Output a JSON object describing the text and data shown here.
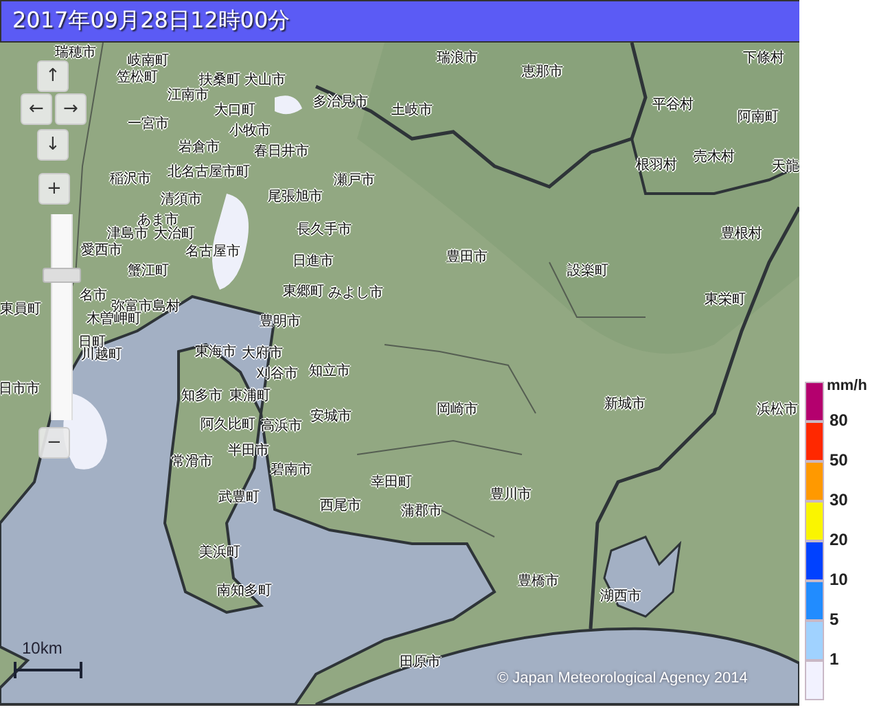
{
  "header": {
    "title": "2017年09月28日12時00分"
  },
  "map": {
    "place_labels": [
      "瑞穂市",
      "岐南町",
      "笠松町",
      "扶桑町",
      "犬山市",
      "江南市",
      "大口町",
      "多治見市",
      "土岐市",
      "瑞浪市",
      "恵那市",
      "平谷村",
      "下條村",
      "阿南町",
      "根羽村",
      "売木村",
      "天龍",
      "豊根村",
      "一宮市",
      "小牧市",
      "岩倉市",
      "春日井市",
      "北名古屋市町",
      "稲沢市",
      "瀬戸市",
      "清須市",
      "尾張旭市",
      "あま市",
      "津島市",
      "大治町",
      "長久手市",
      "愛西市",
      "名古屋市",
      "日進市",
      "蟹江町",
      "豊田市",
      "設楽町",
      "東栄町",
      "東郷町",
      "みよし市",
      "弥富市島村",
      "木曽岬町",
      "東員町",
      "名市",
      "豊明市",
      "日町",
      "川越町",
      "東海市",
      "大府市",
      "刈谷市",
      "知立市",
      "日市市",
      "知多市",
      "東浦町",
      "安城市",
      "岡崎市",
      "新城市",
      "浜松市",
      "阿久比町",
      "高浜市",
      "半田市",
      "常滑市",
      "碧南市",
      "幸田町",
      "西尾市",
      "武豊町",
      "蒲郡市",
      "豊川市",
      "美浜町",
      "南知多町",
      "豊橋市",
      "湖西市",
      "田原市"
    ],
    "pan_buttons": [
      {
        "symbol": "↑"
      },
      {
        "symbol": "←"
      },
      {
        "symbol": "→"
      },
      {
        "symbol": "↓"
      }
    ],
    "zoom_in": "+",
    "zoom_out": "−",
    "zoom_slider": {
      "level": 0.72
    },
    "scale": "10km",
    "copyright": "© Japan Meteorological Agency 2014"
  },
  "legend": {
    "unit": "mm/h",
    "levels": [
      {
        "color": "#b4006e"
      },
      {
        "color": "#ff2800",
        "label": "80"
      },
      {
        "color": "#ff9900",
        "label": "50"
      },
      {
        "color": "#faf500",
        "label": "30"
      },
      {
        "color": "#0041ff",
        "label": "20"
      },
      {
        "color": "#218cff",
        "label": "10"
      },
      {
        "color": "#a0d2ff",
        "label": "5"
      },
      {
        "color": "#f2f2ff",
        "label": "1"
      }
    ]
  }
}
